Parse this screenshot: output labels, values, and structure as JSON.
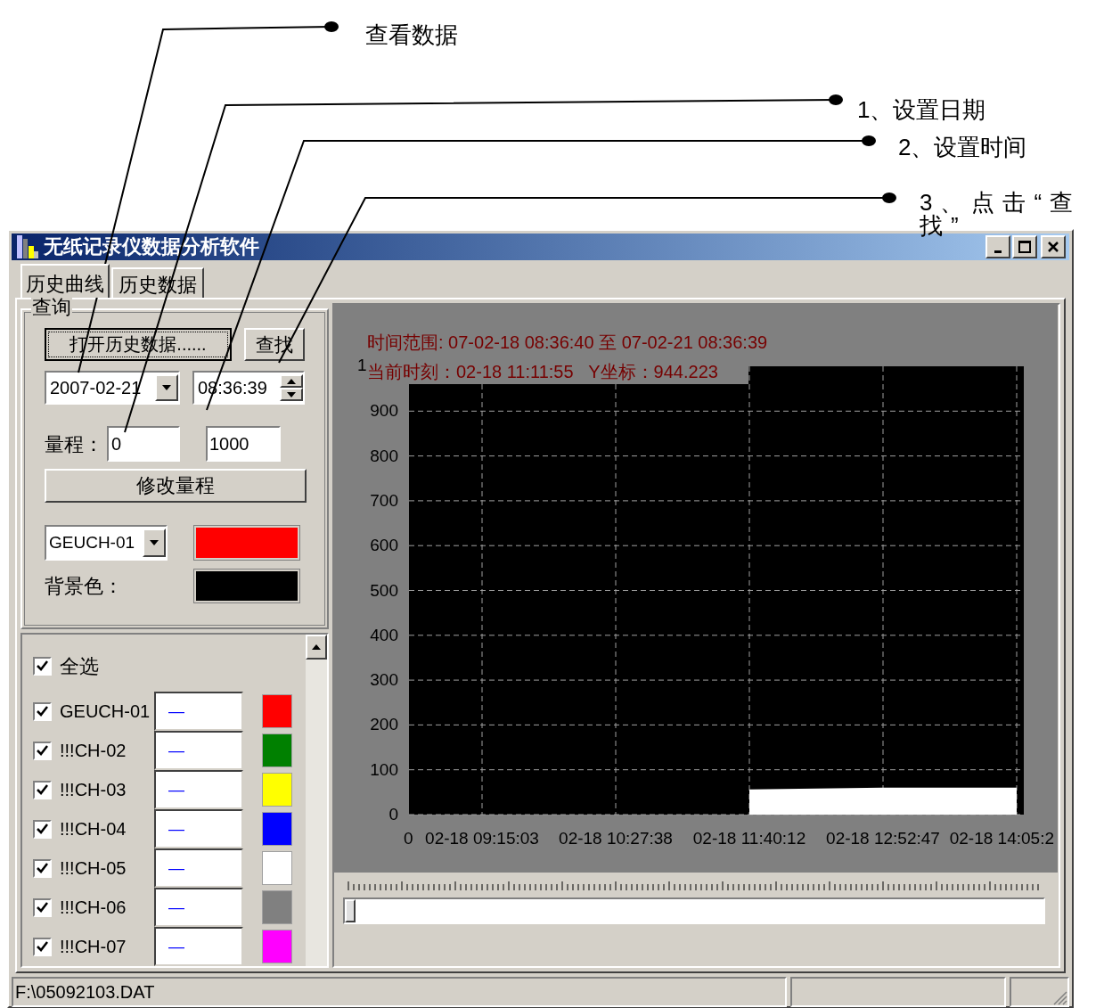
{
  "annotations": [
    {
      "text": "查看数据"
    },
    {
      "text": "1、设置日期"
    },
    {
      "text": "2、设置时间"
    },
    {
      "text": "3、点击“查找”"
    }
  ],
  "window": {
    "title": "无纸记录仪数据分析软件"
  },
  "tabs": [
    {
      "label": "历史曲线",
      "selected": true
    },
    {
      "label": "历史数据",
      "selected": false
    }
  ],
  "query": {
    "title": "查询",
    "open_button": "打开历史数据......",
    "find_button": "查找",
    "date": "2007-02-21",
    "time": "08:36:39",
    "range_label": "量程：",
    "range_min": "0",
    "range_max": "1000",
    "range_button": "修改量程",
    "color_rows": [
      {
        "kind": "channel",
        "value": "GEUCH-01",
        "color": "#ff0000"
      },
      {
        "kind": "background",
        "label": "背景色：",
        "color": "#000000"
      }
    ]
  },
  "channel_list": [
    {
      "name": "全选",
      "checked": true,
      "kind": "all"
    },
    {
      "name": "GEUCH-01",
      "checked": true,
      "kind": "channel",
      "line": "—",
      "color": "#ff0000"
    },
    {
      "name": "!!!CH-02",
      "checked": true,
      "kind": "channel",
      "line": "—",
      "color": "#008000"
    },
    {
      "name": "!!!CH-03",
      "checked": true,
      "kind": "channel",
      "line": "—",
      "color": "#ffff00"
    },
    {
      "name": "!!!CH-04",
      "checked": true,
      "kind": "channel",
      "line": "—",
      "color": "#0000ff"
    },
    {
      "name": "!!!CH-05",
      "checked": true,
      "kind": "channel",
      "line": "—",
      "color": "#ffffff"
    },
    {
      "name": "!!!CH-06",
      "checked": true,
      "kind": "channel",
      "line": "—",
      "color": "#808080"
    },
    {
      "name": "!!!CH-07",
      "checked": true,
      "kind": "channel",
      "line": "—",
      "color": "#ff00ff"
    }
  ],
  "chart_panel": {
    "time_range": "时间范围: 07-02-18 08:36:40 至 07-02-21 08:36:39",
    "cursor_readout": "当前时刻：02-18 11:11:55   Y坐标：944.223",
    "top_label": "1",
    "x_origin_label": "0",
    "chart_data": {
      "type": "area",
      "categories": [
        "02-18 09:15:03",
        "02-18 10:27:38",
        "02-18 11:40:12",
        "02-18 12:52:47",
        "02-18 14:05:2"
      ],
      "series": [
        {
          "color": "#ffffff",
          "values": [
            null,
            null,
            56,
            60,
            60
          ]
        }
      ],
      "ylim": [
        0,
        1000
      ],
      "grid": true,
      "yticks": [
        0,
        100,
        200,
        300,
        400,
        500,
        600,
        700,
        800,
        900
      ]
    },
    "slider": {
      "level": 0
    }
  },
  "status_bar": {
    "file": "F:\\05092103.DAT"
  }
}
